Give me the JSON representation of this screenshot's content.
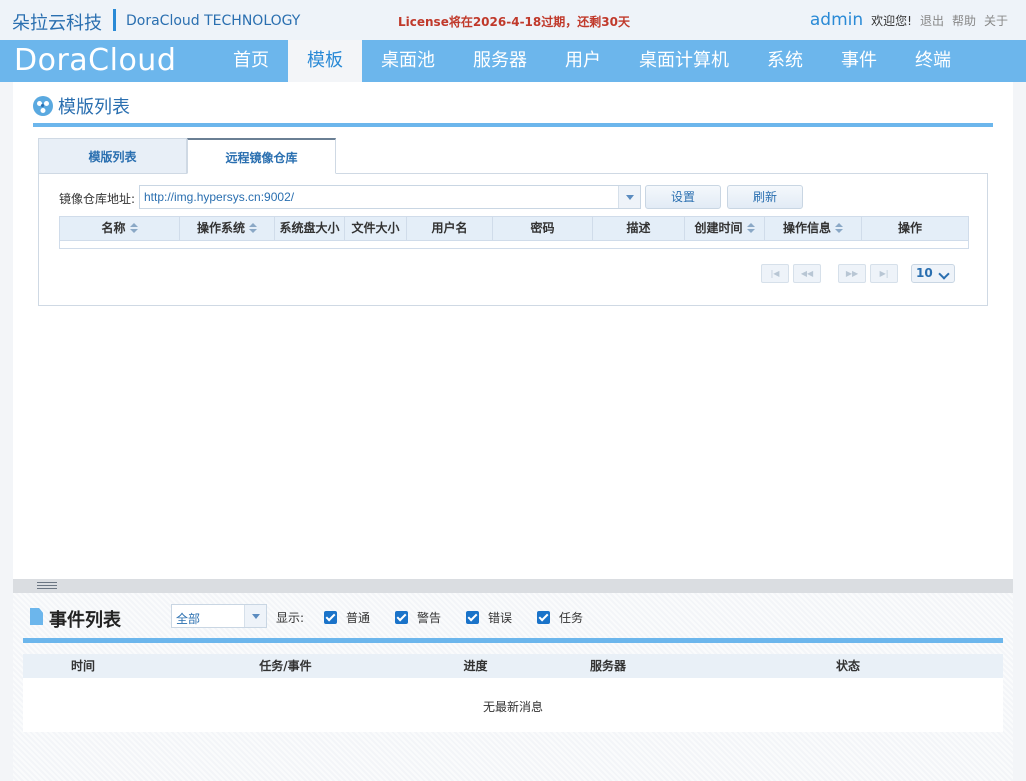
{
  "header": {
    "brand_cn": "朵拉云科技",
    "brand_en": "DoraCloud TECHNOLOGY",
    "license_notice": "License将在2026-4-18过期，还剩30天",
    "username": "admin",
    "welcome": "欢迎您!",
    "links": {
      "logout": "退出",
      "help": "帮助",
      "about": "关于"
    }
  },
  "nav": {
    "logo": "DoraCloud",
    "items": [
      "首页",
      "模板",
      "桌面池",
      "服务器",
      "用户",
      "桌面计算机",
      "系统",
      "事件",
      "终端"
    ],
    "active_index": 1
  },
  "main": {
    "title": "模版列表",
    "tabs": [
      "模版列表",
      "远程镜像仓库"
    ],
    "active_tab": 1,
    "repo": {
      "label": "镜像仓库地址:",
      "value": "http://img.hypersys.cn:9002/",
      "set_button": "设置",
      "refresh_button": "刷新"
    },
    "table": {
      "columns": [
        "名称",
        "操作系统",
        "系统盘大小",
        "文件大小",
        "用户名",
        "密码",
        "描述",
        "创建时间",
        "操作信息",
        "操作"
      ],
      "sortable": [
        true,
        true,
        false,
        false,
        false,
        false,
        false,
        true,
        true,
        false
      ],
      "rows": []
    },
    "pager": {
      "first": "|◀",
      "prev": "◀◀",
      "next": "▶▶",
      "last": "▶|",
      "page_size": "10"
    }
  },
  "events": {
    "title": "事件列表",
    "filter_value": "全部",
    "show_label": "显示:",
    "filters": [
      {
        "label": "普通",
        "checked": true
      },
      {
        "label": "警告",
        "checked": true
      },
      {
        "label": "错误",
        "checked": true
      },
      {
        "label": "任务",
        "checked": true
      }
    ],
    "columns": [
      "时间",
      "任务/事件",
      "进度",
      "服务器",
      "状态"
    ],
    "empty_message": "无最新消息"
  },
  "colors": {
    "nav_bg": "#6cb6ec",
    "accent": "#2a8ad6",
    "license_red": "#c0392b",
    "checkbox": "#1a73c9"
  }
}
